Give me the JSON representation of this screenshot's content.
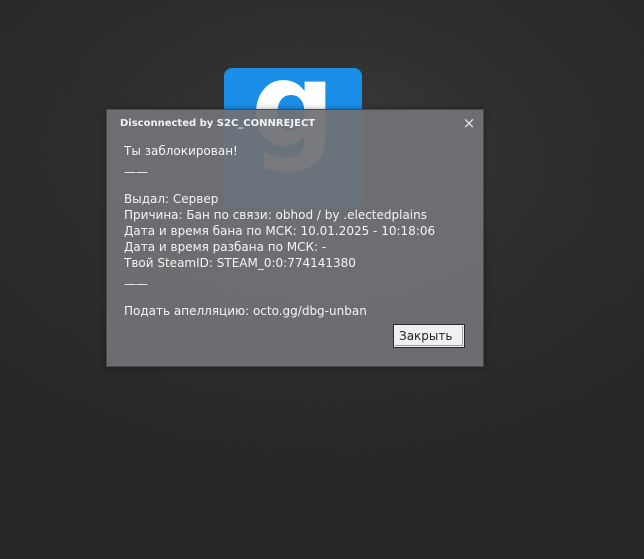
{
  "background": {
    "logo_letter": "g",
    "logo_color": "#1b8ee8"
  },
  "dialog": {
    "title": "Disconnected by S2C_CONNREJECT",
    "close_icon": "×",
    "lines": {
      "banned": "Ты заблокирован!",
      "separator1": "——",
      "issued_by": "Выдал: Сервер",
      "reason": "Причина: Бан по связи: obhod / by .electedplains",
      "ban_date": "Дата и время бана по МСК: 10.01.2025 - 10:18:06",
      "unban_date": "Дата и время разбана по МСК: -",
      "steam_id": "Твой SteamID: STEAM_0:0:774141380",
      "separator2": "——",
      "appeal": "Подать апелляцию: octo.gg/dbg-unban"
    },
    "close_button_label": "Закрыть"
  }
}
